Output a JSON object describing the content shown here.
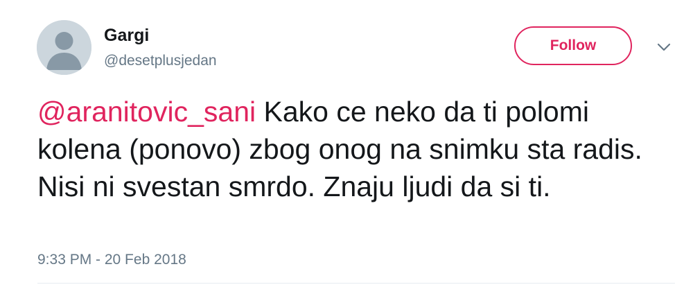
{
  "author": {
    "display_name": "Gargi",
    "handle": "@desetplusjedan",
    "avatar_icon": "default-profile-icon"
  },
  "actions": {
    "follow_label": "Follow",
    "more_icon": "chevron-down-icon"
  },
  "tweet": {
    "mention": "@aranitovic_sani",
    "text": " Kako ce neko da ti polomi kolena (ponovo) zbog onog na snimku sta radis. Nisi ni svestan smrdo. Znaju ljudi da si ti.",
    "timestamp": "9:33 PM - 20 Feb 2018"
  },
  "colors": {
    "accent": "#e0245e",
    "text": "#14171a",
    "secondary_text": "#657786",
    "avatar_bg": "#ccd6dd",
    "avatar_fg": "#8899a6"
  }
}
